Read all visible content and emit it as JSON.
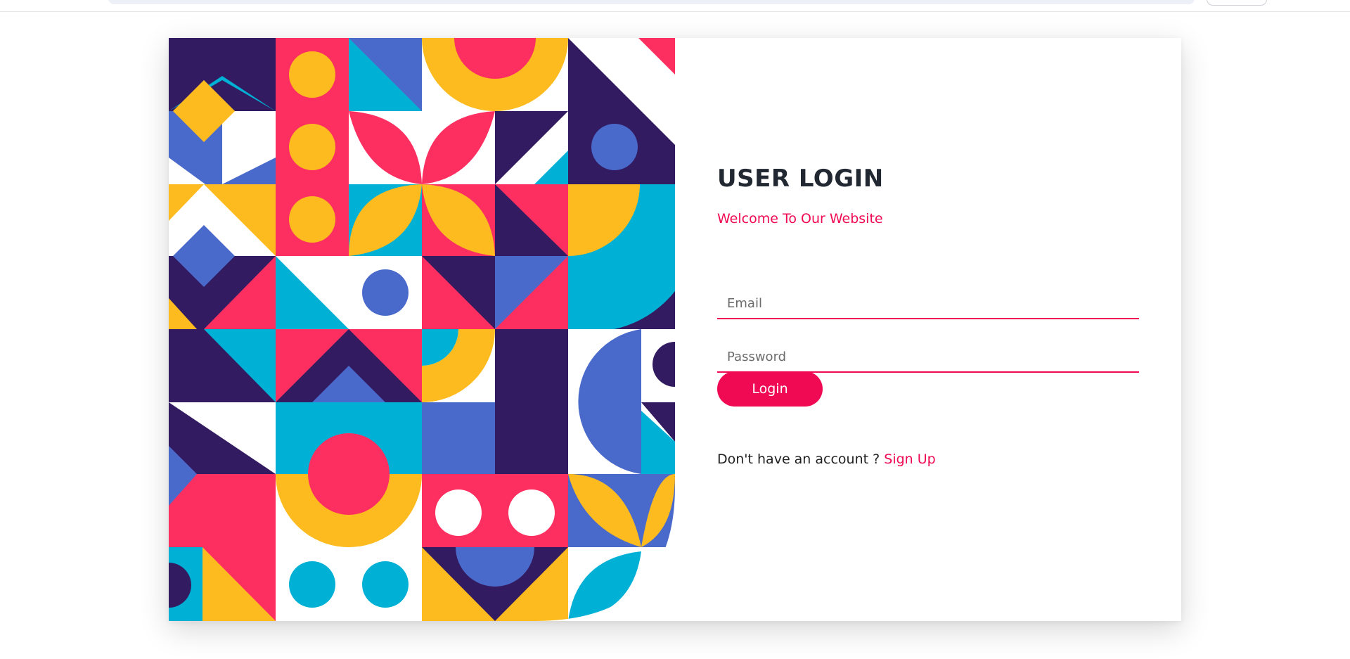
{
  "login": {
    "title": "USER LOGIN",
    "subtitle": "Welcome To Our Website",
    "email_placeholder": "Email",
    "password_placeholder": "Password",
    "button_label": "Login",
    "signup_prompt": "Don't have an account ?",
    "signup_link": "Sign Up"
  },
  "colors": {
    "accent": "#ef0a53",
    "art_navy": "#331b61",
    "art_cyan": "#00b1d5",
    "art_blue": "#4a6acb",
    "art_yellow": "#fdbb1f",
    "art_pink": "#fd2f61"
  }
}
